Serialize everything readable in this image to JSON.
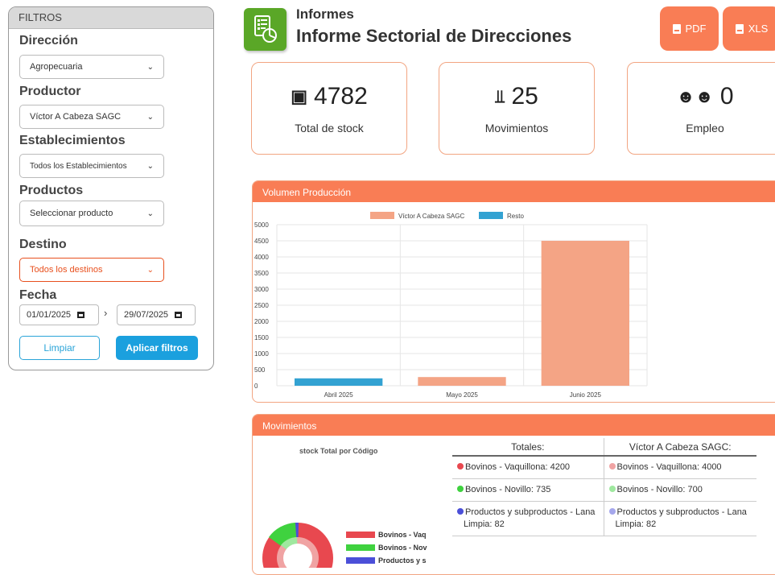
{
  "filters": {
    "title": "FILTROS",
    "direccion": {
      "label": "Dirección",
      "value": "Agropecuaria"
    },
    "productor": {
      "label": "Productor",
      "value": "Víctor A Cabeza SAGC"
    },
    "establecimientos": {
      "label": "Establecimientos",
      "value": "Todos los Establecimientos"
    },
    "productos": {
      "label": "Productos",
      "value": "Seleccionar producto"
    },
    "destino": {
      "label": "Destino",
      "value": "Todos los destinos"
    },
    "fecha": {
      "label": "Fecha",
      "from": "01/01/2025",
      "to": "29/07/2025",
      "separator": "›"
    },
    "clear_label": "Limpiar",
    "apply_label": "Aplicar filtros"
  },
  "header": {
    "breadcrumb": "Informes",
    "title": "Informe Sectorial de Direcciones",
    "pdf_label": "PDF",
    "xls_label": "XLS",
    "accent": "#f97d55"
  },
  "stats": [
    {
      "value": "4782",
      "label": "Total de stock",
      "icon": "boxes-icon"
    },
    {
      "value": "25",
      "label": "Movimientos",
      "icon": "dolly-icon"
    },
    {
      "value": "0",
      "label": "Empleo",
      "icon": "users-icon"
    }
  ],
  "production_panel": {
    "title": "Volumen Producción"
  },
  "movements_panel": {
    "title": "Movimientos",
    "pie_title": "stock Total por Código",
    "pie_legend": [
      "Bovinos - Vaq",
      "Bovinos - Nov",
      "Productos y s"
    ],
    "table_headers": [
      "Totales:",
      "Víctor A Cabeza SAGC:"
    ],
    "rows": [
      {
        "total": "Bovinos - Vaquillona: 4200",
        "producer": "Bovinos - Vaquillona: 4000",
        "color_total": "#e8484f",
        "color_producer": "#f0a3a3"
      },
      {
        "total": "Bovinos - Novillo: 735",
        "producer": "Bovinos - Novillo: 700",
        "color_total": "#3fd23f",
        "color_producer": "#9fe89f"
      },
      {
        "total": "Productos y subproductos - Lana Limpia: 82",
        "producer": "Productos y subproductos - Lana Limpia: 82",
        "color_total": "#4b4fd8",
        "color_producer": "#a5a7ec"
      }
    ]
  },
  "chart_data": {
    "type": "bar",
    "categories": [
      "Abril 2025",
      "Mayo 2025",
      "Junio 2025"
    ],
    "series": [
      {
        "name": "Víctor A Cabeza SAGC",
        "color": "#f4a485",
        "values": [
          0,
          270,
          4500
        ]
      },
      {
        "name": "Resto",
        "color": "#33a2d2",
        "values": [
          230,
          0,
          0
        ]
      }
    ],
    "yticks": [
      "0",
      "500",
      "1000",
      "1500",
      "2000",
      "2500",
      "3000",
      "3500",
      "4000",
      "4500",
      "5000"
    ],
    "ylim": [
      0,
      5000
    ],
    "legend": "top-center",
    "grid": true
  }
}
